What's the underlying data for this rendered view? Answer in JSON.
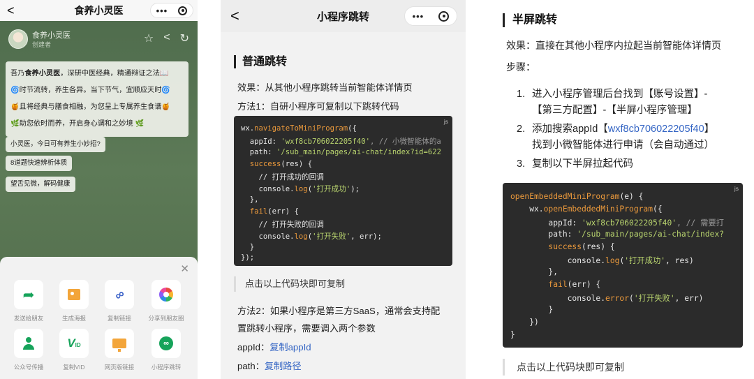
{
  "p1": {
    "nav": {
      "back": "<",
      "title": "食养小灵医",
      "dots": "•••"
    },
    "header": {
      "name": "食养小灵医",
      "creator": "创建者"
    },
    "intro": {
      "l1a": "吾乃",
      "l1b": "食养小灵医",
      "l1c": "，深研中医经典，精通辩证之法📖",
      "l2": "🌀时节流转，养生各异。当下节气，宜顺应天时🌀",
      "l3": "🍯且将经典与膳食相融，为您呈上专属养生食谱🍯",
      "l4": "🌿助您依时而养，开启身心调和之妙境 🌿"
    },
    "chips": [
      "小灵医，今日可有养生小妙招?",
      "8道题快速辨析体质",
      "望舌见微，解码健康"
    ],
    "sheet": {
      "close": "✕",
      "items": [
        {
          "label": "发送给朋友",
          "icon": "share-arrow-icon"
        },
        {
          "label": "生成海报",
          "icon": "poster-icon"
        },
        {
          "label": "复制链接",
          "icon": "link-icon"
        },
        {
          "label": "分享到朋友圈",
          "icon": "moments-icon"
        },
        {
          "label": "公众号传播",
          "icon": "official-account-icon"
        },
        {
          "label": "复制VID",
          "icon": "vid-icon"
        },
        {
          "label": "网页版链接",
          "icon": "web-link-icon"
        },
        {
          "label": "小程序跳转",
          "icon": "miniprogram-icon"
        }
      ]
    }
  },
  "p2": {
    "nav": {
      "back": "<",
      "title": "小程序跳转",
      "dots": "•••"
    },
    "heading": "普通跳转",
    "effect": "效果：从其他小程序跳转当前智能体详情页",
    "method1": "方法1：自研小程序可复制以下跳转代码",
    "code_lang": "js",
    "code": {
      "l1a": "wx.",
      "l1b": "navigateToMiniProgram",
      "l1c": "({",
      "l2a": "  appId: ",
      "l2b": "'wxf8cb706022205f40'",
      "l2c": ", // 小微智能体的a",
      "l3a": "  path: ",
      "l3b": "'/sub_main/pages/ai-chat/index?id=622",
      "l4a": "  ",
      "l4b": "success",
      "l4c": "(res) {",
      "l5": "    // 打开成功的回调",
      "l6a": "    console.",
      "l6b": "log",
      "l6c": "(",
      "l6d": "'打开成功'",
      "l6e": ");",
      "l7": "  },",
      "l8a": "  ",
      "l8b": "fail",
      "l8c": "(err) {",
      "l9": "    // 打开失败的回调",
      "l10a": "    console.",
      "l10b": "log",
      "l10c": "(",
      "l10d": "'打开失败'",
      "l10e": ", err);",
      "l11": "  }",
      "l12": "});"
    },
    "copy_tip": "点击以上代码块即可复制",
    "method2_line1": "方法2：如果小程序是第三方SaaS，通常会支持配",
    "method2_line2": "置跳转小程序，需要调入两个参数",
    "appid_label": "appId：",
    "appid_link": "复制appId",
    "path_label": "path：",
    "path_link": "复制路径"
  },
  "p3": {
    "heading": "半屏跳转",
    "effect": "效果：直接在其他小程序内拉起当前智能体详情页",
    "steps_label": "步骤：",
    "steps": {
      "s1n": "1.",
      "s1a": "进入小程序管理后台找到【账号设置】-",
      "s1b": "【第三方配置】-【半屏小程序管理】",
      "s2n": "2.",
      "s2a": "添加搜索appId【",
      "s2link": "wxf8cb706022205f40",
      "s2c": "】",
      "s2b": "找到小微智能体进行申请（会自动通过）",
      "s3n": "3.",
      "s3a": "复制以下半屏拉起代码"
    },
    "code_lang": "js",
    "code": {
      "l1a": "openEmbeddedMiniProgram",
      "l1b": "(e) {",
      "l2a": "    wx.",
      "l2b": "openEmbeddedMiniProgram",
      "l2c": "({",
      "l3a": "        appId: ",
      "l3b": "'wxf8cb706022205f40'",
      "l3c": ", // 需要打",
      "l4a": "        path: ",
      "l4b": "'/sub_main/pages/ai-chat/index?",
      "l5a": "        ",
      "l5b": "success",
      "l5c": "(res) {",
      "l6a": "            console.",
      "l6b": "log",
      "l6c": "(",
      "l6d": "'打开成功'",
      "l6e": ", res)",
      "l7": "        },",
      "l8a": "        ",
      "l8b": "fail",
      "l8c": "(err) {",
      "l9a": "            console.",
      "l9b": "error",
      "l9c": "(",
      "l9d": "'打开失败'",
      "l9e": ", err)",
      "l10": "        }",
      "l11": "    })",
      "l12": "}"
    },
    "copy_tip": "点击以上代码块即可复制"
  }
}
